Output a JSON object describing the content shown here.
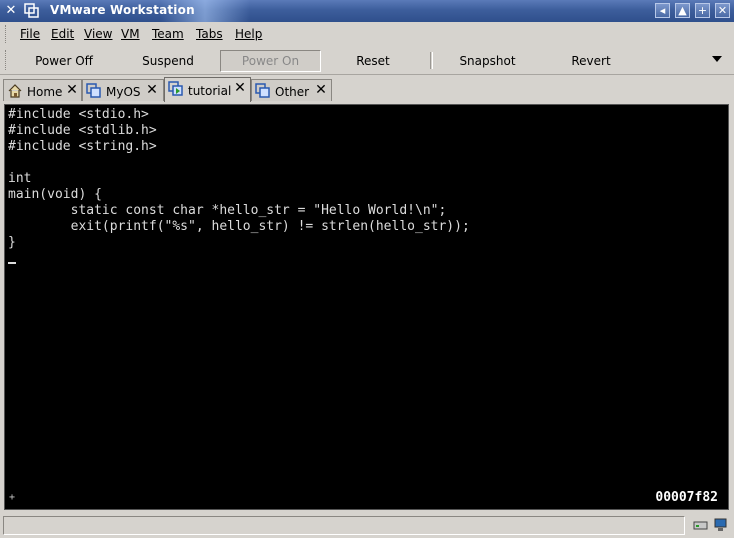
{
  "window": {
    "title": "VMware Workstation",
    "controls": [
      "◂▸",
      "▲",
      "+",
      "✕"
    ]
  },
  "menu": [
    {
      "label": "File"
    },
    {
      "label": "Edit"
    },
    {
      "label": "View"
    },
    {
      "label": "VM"
    },
    {
      "label": "Team"
    },
    {
      "label": "Tabs"
    },
    {
      "label": "Help"
    }
  ],
  "toolbar": {
    "power_off": "Power Off",
    "suspend": "Suspend",
    "power_on": "Power On",
    "reset": "Reset",
    "snapshot": "Snapshot",
    "revert": "Revert"
  },
  "tabs": [
    {
      "label": "Home",
      "icon": "home-icon",
      "active": false
    },
    {
      "label": "MyOS",
      "icon": "vm-icon",
      "active": false
    },
    {
      "label": "tutorial",
      "icon": "vm-running-icon",
      "active": true
    },
    {
      "label": "Other",
      "icon": "vm-icon",
      "active": false
    }
  ],
  "console": {
    "code": "#include <stdio.h>\n#include <stdlib.h>\n#include <string.h>\n\nint\nmain(void) {\n        static const char *hello_str = \"Hello World!\\n\";\n        exit(printf(\"%s\", hello_str) != strlen(hello_str));\n}",
    "corner_mark": "+",
    "address": "00007f82"
  },
  "statusbar": {
    "icons": [
      "hard-disk-icon",
      "network-icon"
    ]
  },
  "colors": {
    "titlebar": "#3d5e9c",
    "chrome": "#d6d3ce",
    "console_bg": "#000000",
    "console_fg": "#dcdcdc"
  }
}
